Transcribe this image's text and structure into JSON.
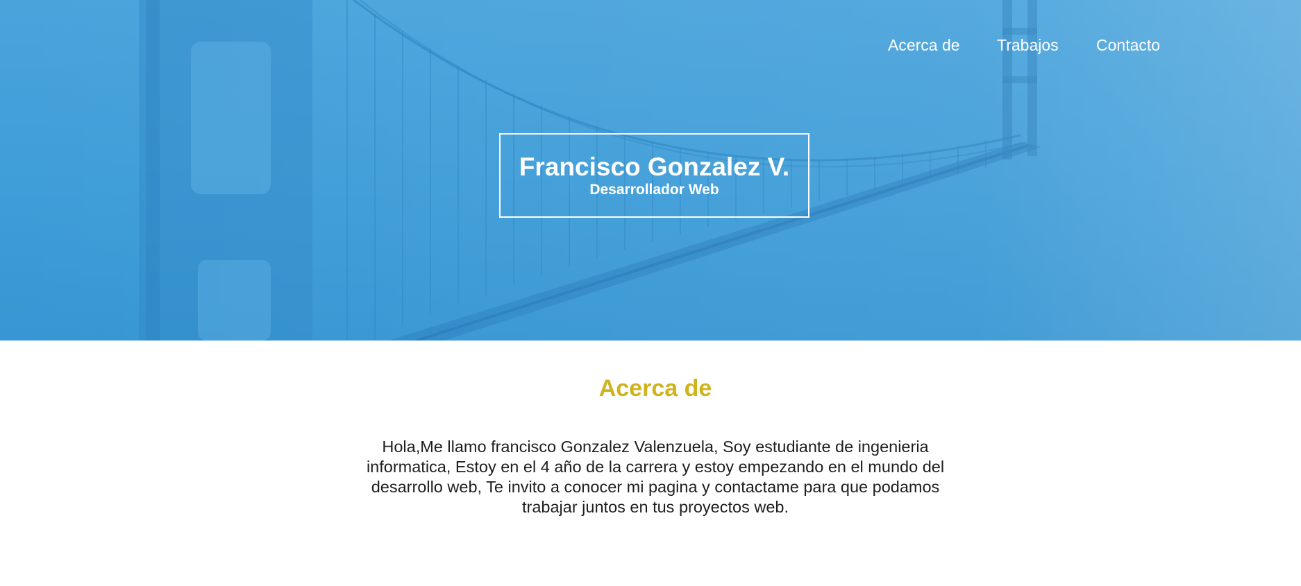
{
  "colors": {
    "hero_blue": "#4aa4dc",
    "heading_gold": "#cfb31d",
    "text": "#1e1e1e"
  },
  "hero": {
    "background": "bridge-photo-blue-tint"
  },
  "nav": {
    "items": [
      {
        "label": "Acerca de"
      },
      {
        "label": "Trabajos"
      },
      {
        "label": "Contacto"
      }
    ]
  },
  "header": {
    "name": "Francisco Gonzalez V.",
    "role": "Desarrollador Web"
  },
  "about": {
    "heading": "Acerca de",
    "body": "Hola,Me llamo francisco Gonzalez Valenzuela, Soy estudiante de ingenieria informatica, Estoy en el 4 año de la carrera y estoy empezando en el mundo del desarrollo web, Te invito a conocer mi pagina y contactame para que podamos trabajar juntos en tus proyectos web."
  }
}
